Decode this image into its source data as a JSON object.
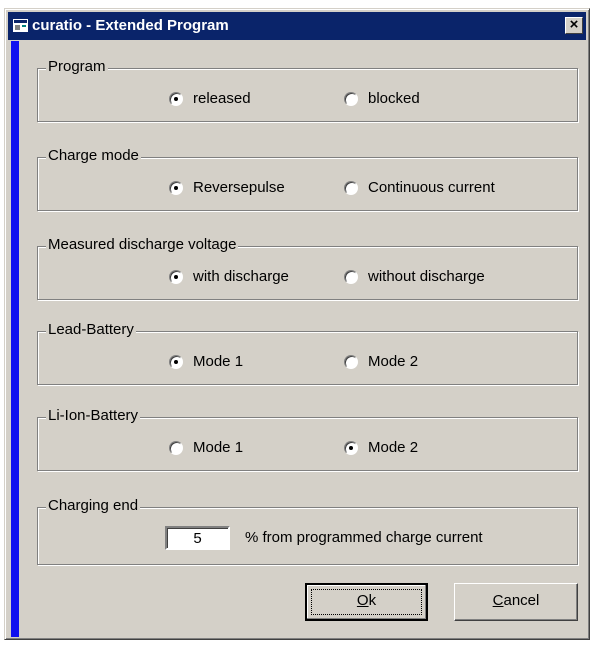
{
  "window": {
    "title": "curatio - Extended Program",
    "icon": "app-icon",
    "close_glyph": "×",
    "accent_color": "#1010f0",
    "titlebar_color": "#0a246a"
  },
  "groups": [
    {
      "id": "program",
      "title": "Program",
      "options": [
        {
          "label": "released",
          "selected": true
        },
        {
          "label": "blocked",
          "selected": false
        }
      ]
    },
    {
      "id": "charge-mode",
      "title": "Charge mode",
      "options": [
        {
          "label": "Reversepulse",
          "selected": true
        },
        {
          "label": "Continuous current",
          "selected": false
        }
      ]
    },
    {
      "id": "measured-discharge-voltage",
      "title": "Measured discharge voltage",
      "options": [
        {
          "label": "with discharge",
          "selected": true
        },
        {
          "label": "without discharge",
          "selected": false
        }
      ]
    },
    {
      "id": "lead-battery",
      "title": "Lead-Battery",
      "options": [
        {
          "label": "Mode 1",
          "selected": true
        },
        {
          "label": "Mode 2",
          "selected": false
        }
      ]
    },
    {
      "id": "li-ion-battery",
      "title": "Li-Ion-Battery",
      "options": [
        {
          "label": "Mode 1",
          "selected": false
        },
        {
          "label": "Mode 2",
          "selected": true
        }
      ]
    }
  ],
  "charging_end": {
    "title": "Charging end",
    "value": "5",
    "suffix": "% from programmed charge current"
  },
  "buttons": {
    "ok": {
      "mnemonic": "O",
      "rest": "k"
    },
    "cancel": {
      "mnemonic": "C",
      "rest": "ancel"
    }
  }
}
